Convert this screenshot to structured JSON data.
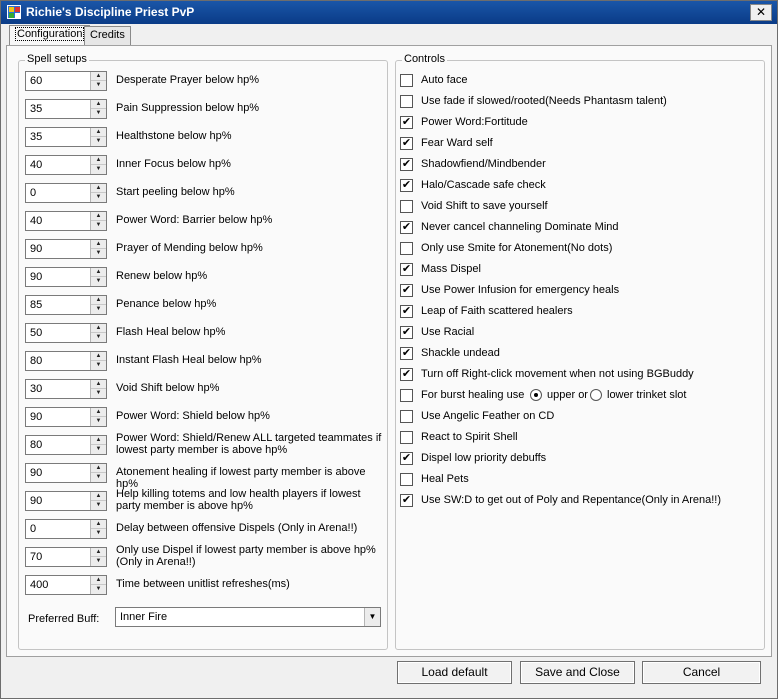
{
  "window": {
    "title": "Richie's Discipline Priest PvP",
    "close_label": "✕"
  },
  "tabs": [
    {
      "label": "Configuration",
      "active": true
    },
    {
      "label": "Credits",
      "active": false
    }
  ],
  "spell_setups": {
    "title": "Spell setups",
    "rows": [
      {
        "value": "60",
        "label": "Desperate Prayer below hp%"
      },
      {
        "value": "35",
        "label": "Pain Suppression below hp%"
      },
      {
        "value": "35",
        "label": "Healthstone below hp%"
      },
      {
        "value": "40",
        "label": "Inner Focus below hp%"
      },
      {
        "value": "0",
        "label": "Start peeling below hp%"
      },
      {
        "value": "40",
        "label": "Power Word: Barrier below hp%"
      },
      {
        "value": "90",
        "label": "Prayer of Mending below hp%"
      },
      {
        "value": "90",
        "label": "Renew below hp%"
      },
      {
        "value": "85",
        "label": "Penance below hp%"
      },
      {
        "value": "50",
        "label": "Flash Heal below hp%"
      },
      {
        "value": "80",
        "label": "Instant Flash Heal below hp%"
      },
      {
        "value": "30",
        "label": "Void Shift below hp%"
      },
      {
        "value": "90",
        "label": "Power Word: Shield below hp%"
      },
      {
        "value": "80",
        "label": "Power Word: Shield/Renew ALL targeted teammates if lowest party member is above hp%"
      },
      {
        "value": "90",
        "label": "Atonement healing if lowest party member is above hp%"
      },
      {
        "value": "90",
        "label": "Help killing totems and low health players if lowest party member is above hp%"
      },
      {
        "value": "0",
        "label": "Delay between offensive Dispels (Only in Arena!!)"
      },
      {
        "value": "70",
        "label": "Only use Dispel if lowest party member is above hp% (Only in Arena!!)"
      },
      {
        "value": "400",
        "label": "Time between unitlist refreshes(ms)"
      }
    ],
    "preferred_buff_label": "Preferred Buff:",
    "preferred_buff_value": "Inner Fire"
  },
  "controls": {
    "title": "Controls",
    "items": [
      {
        "label": "Auto face",
        "checked": false
      },
      {
        "label": "Use fade if slowed/rooted(Needs Phantasm talent)",
        "checked": false
      },
      {
        "label": "Power Word:Fortitude",
        "checked": true
      },
      {
        "label": "Fear Ward self",
        "checked": true
      },
      {
        "label": "Shadowfiend/Mindbender",
        "checked": true
      },
      {
        "label": "Halo/Cascade safe check",
        "checked": true
      },
      {
        "label": "Void Shift to save yourself",
        "checked": false
      },
      {
        "label": "Never cancel channeling Dominate Mind",
        "checked": true
      },
      {
        "label": "Only use Smite for Atonement(No dots)",
        "checked": false
      },
      {
        "label": "Mass Dispel",
        "checked": true
      },
      {
        "label": "Use Power Infusion for emergency heals",
        "checked": true
      },
      {
        "label": "Leap of Faith scattered healers",
        "checked": true
      },
      {
        "label": "Use Racial",
        "checked": true
      },
      {
        "label": "Shackle undead",
        "checked": true
      },
      {
        "label": "Turn off Right-click movement when not using BGBuddy",
        "checked": true
      },
      {
        "label": "For burst healing use",
        "checked": false
      },
      {
        "label": "Use Angelic Feather on CD",
        "checked": false
      },
      {
        "label": "React to Spirit Shell",
        "checked": false
      },
      {
        "label": "Dispel low priority debuffs",
        "checked": true
      },
      {
        "label": "Heal Pets",
        "checked": false
      },
      {
        "label": "Use SW:D to get out of Poly and Repentance(Only in Arena!!)",
        "checked": true
      }
    ],
    "trinket_upper_label": "upper or",
    "trinket_lower_label": "lower trinket slot"
  },
  "buttons": {
    "load_default": "Load default",
    "save_close": "Save and Close",
    "cancel": "Cancel"
  }
}
